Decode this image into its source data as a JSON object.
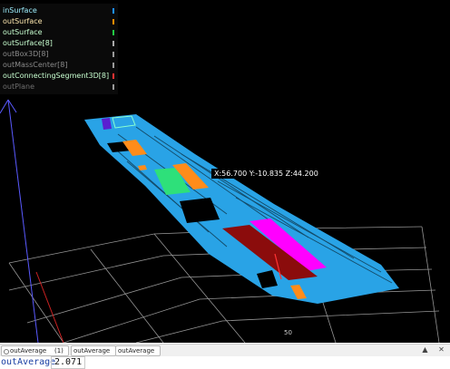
{
  "layers": [
    {
      "name": "inSurface",
      "text_color": "#9ef0ff",
      "swatch": "#1e90ff"
    },
    {
      "name": "outSurface",
      "text_color": "#ffe9b0",
      "swatch": "#ff8c00"
    },
    {
      "name": "outSurface",
      "text_color": "#c8ffd0",
      "swatch": "#22cc44"
    },
    {
      "name": "outSurface[8]",
      "text_color": "#c8ffd0",
      "swatch": "#aaaaaa"
    },
    {
      "name": "outBox3D[8]",
      "text_color": "#8a8a8a",
      "swatch": "#9a9a9a"
    },
    {
      "name": "outMassCenter[8]",
      "text_color": "#8a8a8a",
      "swatch": "#9a9a9a"
    },
    {
      "name": "outConnectingSegment3D[8]",
      "text_color": "#c8ffd0",
      "swatch": "#ff3333"
    },
    {
      "name": "outPlane",
      "text_color": "#6e6e6e",
      "swatch": "#9a9a9a"
    }
  ],
  "viewport": {
    "coordinate_readout": "X:56.700  Y:-10.835  Z:44.200",
    "grid_tick": "50"
  },
  "colors": {
    "surface": "#29a3e6",
    "orange": "#ff8c1a",
    "green": "#2ee07a",
    "magenta": "#ff00ff",
    "darkred": "#8b0c0c",
    "purple": "#5a1fd1",
    "grid": "#c8c8c8"
  },
  "tabs": [
    {
      "label": "outAverage",
      "count": "(1)"
    },
    {
      "label": "outAverage"
    },
    {
      "label": "outAverage"
    }
  ],
  "icons": {
    "pin": "pin-icon",
    "close": "close-icon"
  },
  "output": {
    "label": "outAverage",
    "value": "2.071"
  }
}
